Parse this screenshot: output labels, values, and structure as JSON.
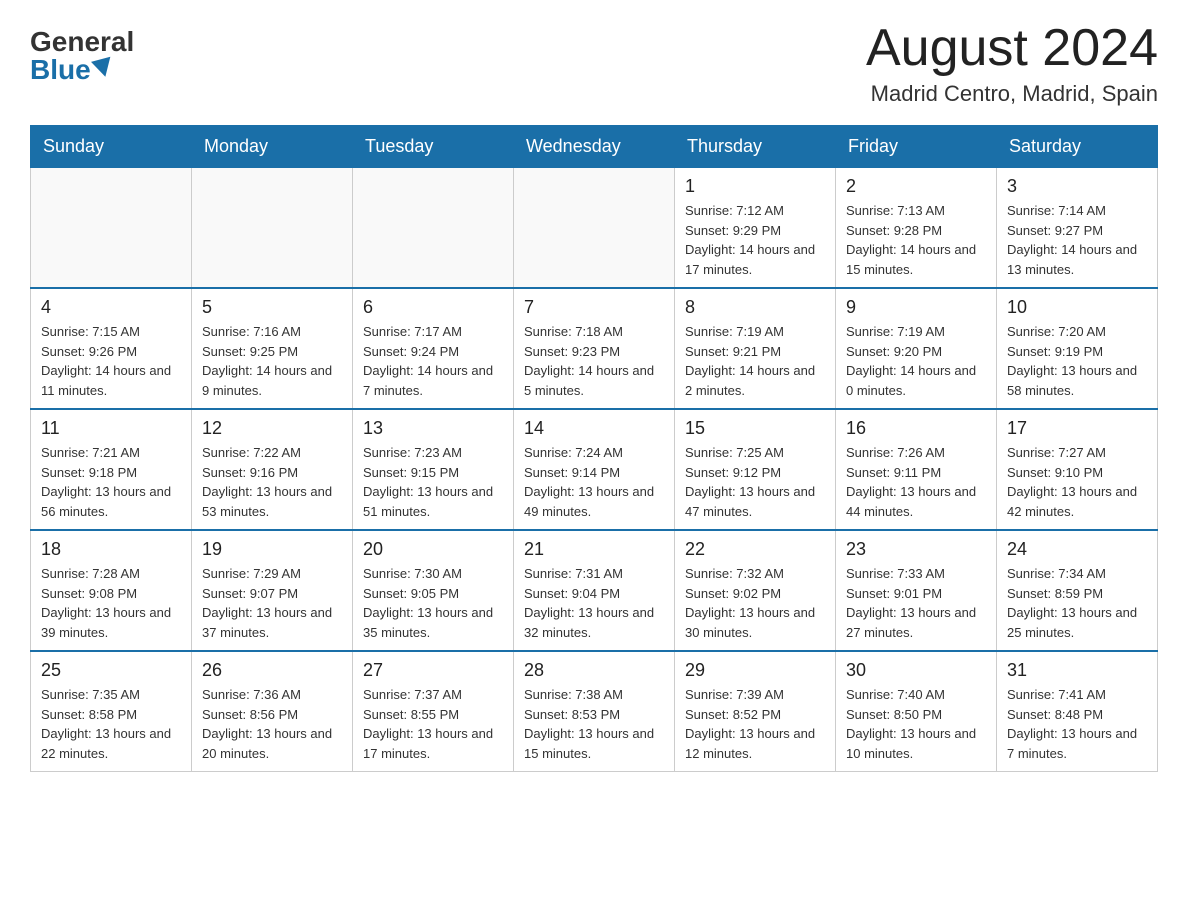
{
  "logo": {
    "general": "General",
    "blue": "Blue"
  },
  "title": {
    "month_year": "August 2024",
    "location": "Madrid Centro, Madrid, Spain"
  },
  "days_of_week": [
    "Sunday",
    "Monday",
    "Tuesday",
    "Wednesday",
    "Thursday",
    "Friday",
    "Saturday"
  ],
  "weeks": [
    [
      {
        "day": "",
        "info": ""
      },
      {
        "day": "",
        "info": ""
      },
      {
        "day": "",
        "info": ""
      },
      {
        "day": "",
        "info": ""
      },
      {
        "day": "1",
        "info": "Sunrise: 7:12 AM\nSunset: 9:29 PM\nDaylight: 14 hours and 17 minutes."
      },
      {
        "day": "2",
        "info": "Sunrise: 7:13 AM\nSunset: 9:28 PM\nDaylight: 14 hours and 15 minutes."
      },
      {
        "day": "3",
        "info": "Sunrise: 7:14 AM\nSunset: 9:27 PM\nDaylight: 14 hours and 13 minutes."
      }
    ],
    [
      {
        "day": "4",
        "info": "Sunrise: 7:15 AM\nSunset: 9:26 PM\nDaylight: 14 hours and 11 minutes."
      },
      {
        "day": "5",
        "info": "Sunrise: 7:16 AM\nSunset: 9:25 PM\nDaylight: 14 hours and 9 minutes."
      },
      {
        "day": "6",
        "info": "Sunrise: 7:17 AM\nSunset: 9:24 PM\nDaylight: 14 hours and 7 minutes."
      },
      {
        "day": "7",
        "info": "Sunrise: 7:18 AM\nSunset: 9:23 PM\nDaylight: 14 hours and 5 minutes."
      },
      {
        "day": "8",
        "info": "Sunrise: 7:19 AM\nSunset: 9:21 PM\nDaylight: 14 hours and 2 minutes."
      },
      {
        "day": "9",
        "info": "Sunrise: 7:19 AM\nSunset: 9:20 PM\nDaylight: 14 hours and 0 minutes."
      },
      {
        "day": "10",
        "info": "Sunrise: 7:20 AM\nSunset: 9:19 PM\nDaylight: 13 hours and 58 minutes."
      }
    ],
    [
      {
        "day": "11",
        "info": "Sunrise: 7:21 AM\nSunset: 9:18 PM\nDaylight: 13 hours and 56 minutes."
      },
      {
        "day": "12",
        "info": "Sunrise: 7:22 AM\nSunset: 9:16 PM\nDaylight: 13 hours and 53 minutes."
      },
      {
        "day": "13",
        "info": "Sunrise: 7:23 AM\nSunset: 9:15 PM\nDaylight: 13 hours and 51 minutes."
      },
      {
        "day": "14",
        "info": "Sunrise: 7:24 AM\nSunset: 9:14 PM\nDaylight: 13 hours and 49 minutes."
      },
      {
        "day": "15",
        "info": "Sunrise: 7:25 AM\nSunset: 9:12 PM\nDaylight: 13 hours and 47 minutes."
      },
      {
        "day": "16",
        "info": "Sunrise: 7:26 AM\nSunset: 9:11 PM\nDaylight: 13 hours and 44 minutes."
      },
      {
        "day": "17",
        "info": "Sunrise: 7:27 AM\nSunset: 9:10 PM\nDaylight: 13 hours and 42 minutes."
      }
    ],
    [
      {
        "day": "18",
        "info": "Sunrise: 7:28 AM\nSunset: 9:08 PM\nDaylight: 13 hours and 39 minutes."
      },
      {
        "day": "19",
        "info": "Sunrise: 7:29 AM\nSunset: 9:07 PM\nDaylight: 13 hours and 37 minutes."
      },
      {
        "day": "20",
        "info": "Sunrise: 7:30 AM\nSunset: 9:05 PM\nDaylight: 13 hours and 35 minutes."
      },
      {
        "day": "21",
        "info": "Sunrise: 7:31 AM\nSunset: 9:04 PM\nDaylight: 13 hours and 32 minutes."
      },
      {
        "day": "22",
        "info": "Sunrise: 7:32 AM\nSunset: 9:02 PM\nDaylight: 13 hours and 30 minutes."
      },
      {
        "day": "23",
        "info": "Sunrise: 7:33 AM\nSunset: 9:01 PM\nDaylight: 13 hours and 27 minutes."
      },
      {
        "day": "24",
        "info": "Sunrise: 7:34 AM\nSunset: 8:59 PM\nDaylight: 13 hours and 25 minutes."
      }
    ],
    [
      {
        "day": "25",
        "info": "Sunrise: 7:35 AM\nSunset: 8:58 PM\nDaylight: 13 hours and 22 minutes."
      },
      {
        "day": "26",
        "info": "Sunrise: 7:36 AM\nSunset: 8:56 PM\nDaylight: 13 hours and 20 minutes."
      },
      {
        "day": "27",
        "info": "Sunrise: 7:37 AM\nSunset: 8:55 PM\nDaylight: 13 hours and 17 minutes."
      },
      {
        "day": "28",
        "info": "Sunrise: 7:38 AM\nSunset: 8:53 PM\nDaylight: 13 hours and 15 minutes."
      },
      {
        "day": "29",
        "info": "Sunrise: 7:39 AM\nSunset: 8:52 PM\nDaylight: 13 hours and 12 minutes."
      },
      {
        "day": "30",
        "info": "Sunrise: 7:40 AM\nSunset: 8:50 PM\nDaylight: 13 hours and 10 minutes."
      },
      {
        "day": "31",
        "info": "Sunrise: 7:41 AM\nSunset: 8:48 PM\nDaylight: 13 hours and 7 minutes."
      }
    ]
  ]
}
